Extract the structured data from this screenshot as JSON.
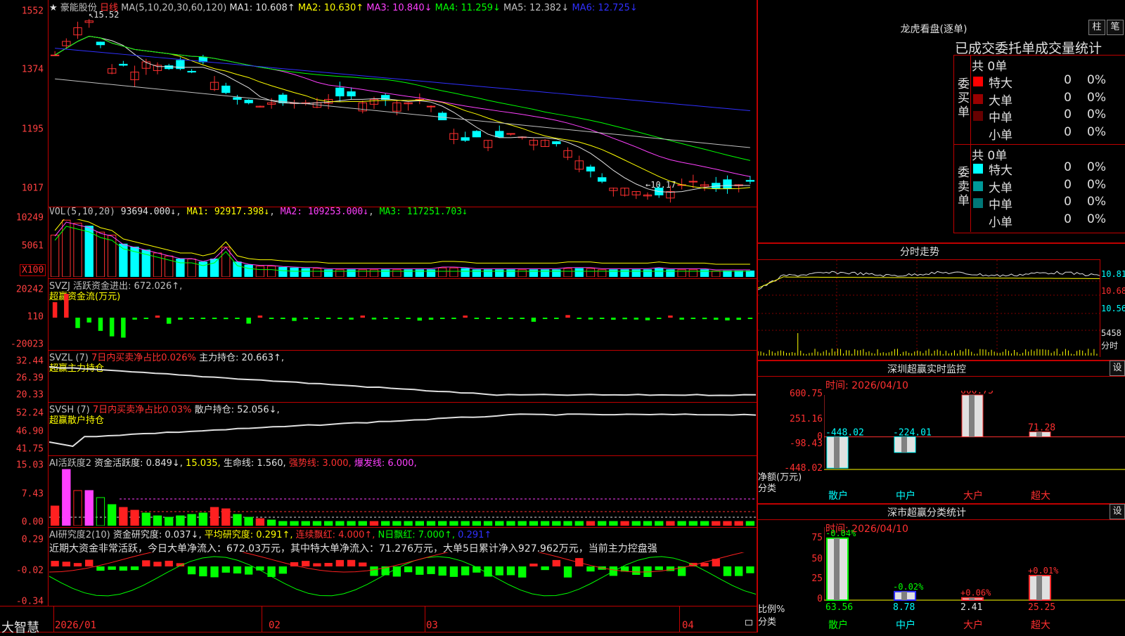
{
  "header": {
    "star": "★",
    "stock_name": "豪能股份",
    "period": "日线",
    "ma_prefix": "MA(5,10,20,30,60,120)",
    "ma": [
      {
        "label": "MA1:",
        "value": "10.608↑",
        "color": "#e0e0e0"
      },
      {
        "label": "MA2:",
        "value": "10.630↑",
        "color": "#ffff00"
      },
      {
        "label": "MA3:",
        "value": "10.840↓",
        "color": "#ff40ff"
      },
      {
        "label": "MA4:",
        "value": "11.259↓",
        "color": "#00ff00"
      },
      {
        "label": "MA5:",
        "value": "12.382↓",
        "color": "#c0c0c0"
      },
      {
        "label": "MA6:",
        "value": "12.725↓",
        "color": "#3030ff"
      }
    ],
    "max_mark": "15.52",
    "min_mark": "←10.17"
  },
  "price_axis": [
    "1552",
    "1374",
    "1195",
    "1017"
  ],
  "vol": {
    "title": "VOL(5,10,20)",
    "value": "93694.000↓",
    "ma1": "MA1: 92917.398↓",
    "ma2": "MA2: 109253.000↓",
    "ma3": "MA3: 117251.703↓",
    "axis": [
      "10249",
      "5061"
    ],
    "unit": "X100"
  },
  "svzj": {
    "title": "SVZJ  活跃资金进出: 672.026↑,",
    "subtitle": "超赢资金流(万元)",
    "axis": [
      "20242",
      "110",
      "-20023"
    ]
  },
  "svzl": {
    "title": "SVZL (7)",
    "red": "7日内买卖净占比0.026%",
    "rest": "主力持仓: 20.663↑,",
    "subtitle": "超赢主力持仓",
    "axis": [
      "32.44",
      "26.39",
      "20.33"
    ]
  },
  "svsh": {
    "title": "SVSH (7)",
    "red": "7日内买卖净占比0.03%",
    "rest": "散户持仓: 52.056↓,",
    "subtitle": "超赢散户持仓",
    "axis": [
      "52.24",
      "46.90",
      "41.75"
    ]
  },
  "ai1": {
    "title": "AI活跃度2",
    "a": "资金活跃度: 0.849↓,",
    "b": "15.035,",
    "c": "生命线: 1.560,",
    "d": "强势线: 3.000,",
    "e": "爆发线: 6.000,",
    "axis": [
      "15.03",
      "7.43",
      "0.00"
    ]
  },
  "ai2": {
    "title": "AI研究度2(10)",
    "a": "资金研究度: 0.037↓,",
    "b": "平均研究度: 0.291↑,",
    "c": "连续飘红: 4.000↑,",
    "d": "N日飘红: 7.000↑,",
    "e": "0.291↑",
    "note": "近期大资金非常活跃，今日大单净流入：672.03万元，其中特大单净流入：71.276万元，大单5日累计净入927.962万元，当前主力控盘强",
    "axis": [
      "0.29",
      "-0.02",
      "-0.34"
    ]
  },
  "xaxis": {
    "brand": "大智慧",
    "dates": [
      "2026/01",
      "02",
      "03",
      "04"
    ]
  },
  "longhu": {
    "title": "龙虎看盘(逐单)",
    "btn_zhu": "柱",
    "btn_bi": "笔",
    "subtitle": "已成交委托单成交量统计",
    "buy_total": "共 0单",
    "sell_total": "共 0单",
    "buy_label": "委买单",
    "sell_label": "委卖单",
    "buy_rows": [
      {
        "name": "特大",
        "qty": "0",
        "pct": "0%",
        "color": "#ff0000"
      },
      {
        "name": "大单",
        "qty": "0",
        "pct": "0%",
        "color": "#990000"
      },
      {
        "name": "中单",
        "qty": "0",
        "pct": "0%",
        "color": "#660000"
      },
      {
        "name": "小单",
        "qty": "0",
        "pct": "0%",
        "color": "#000000"
      }
    ],
    "sell_rows": [
      {
        "name": "特大",
        "qty": "0",
        "pct": "0%",
        "color": "#00ffff"
      },
      {
        "name": "大单",
        "qty": "0",
        "pct": "0%",
        "color": "#009999"
      },
      {
        "name": "中单",
        "qty": "0",
        "pct": "0%",
        "color": "#007777"
      },
      {
        "name": "小单",
        "qty": "0",
        "pct": "0%",
        "color": "#000000"
      }
    ]
  },
  "fenshi": {
    "title": "分时走势",
    "axis": [
      "10.81",
      "10.68",
      "10.56"
    ],
    "vol_axis": "5458",
    "vol_label": "分时"
  },
  "szmon": {
    "title": "深圳超赢实时监控",
    "btn": "设",
    "time": "时间: 2026/04/10",
    "axis": [
      "600.75",
      "251.16",
      "0",
      "-98.43",
      "-448.02"
    ],
    "ylabel": "净额(万元)",
    "xlabel": "分类",
    "categories": [
      "散户",
      "中户",
      "大户",
      "超大"
    ]
  },
  "szstat": {
    "title": "深市超赢分类统计",
    "btn": "设",
    "time": "时间: 2026/04/10",
    "axis": [
      "75",
      "50",
      "25",
      "0"
    ],
    "ylabel": "比例%",
    "xlabel": "分类",
    "categories": [
      "散户",
      "中户",
      "大户",
      "超大"
    ]
  },
  "chart_data": [
    {
      "type": "bar",
      "title": "深圳超赢实时监控",
      "ylabel": "净额(万元)",
      "categories": [
        "散户",
        "中户",
        "大户",
        "超大"
      ],
      "values": [
        -448.02,
        -224.01,
        600.75,
        71.28
      ],
      "ylim": [
        -448.02,
        600.75
      ]
    },
    {
      "type": "bar",
      "title": "深市超赢分类统计",
      "ylabel": "比例%",
      "categories": [
        "散户",
        "中户",
        "大户",
        "超大"
      ],
      "values": [
        63.56,
        8.78,
        2.41,
        25.25
      ],
      "changes": [
        "-0.04%",
        "-0.02%",
        "+0.06%",
        "+0.01%"
      ],
      "ylim": [
        0,
        75
      ]
    }
  ]
}
